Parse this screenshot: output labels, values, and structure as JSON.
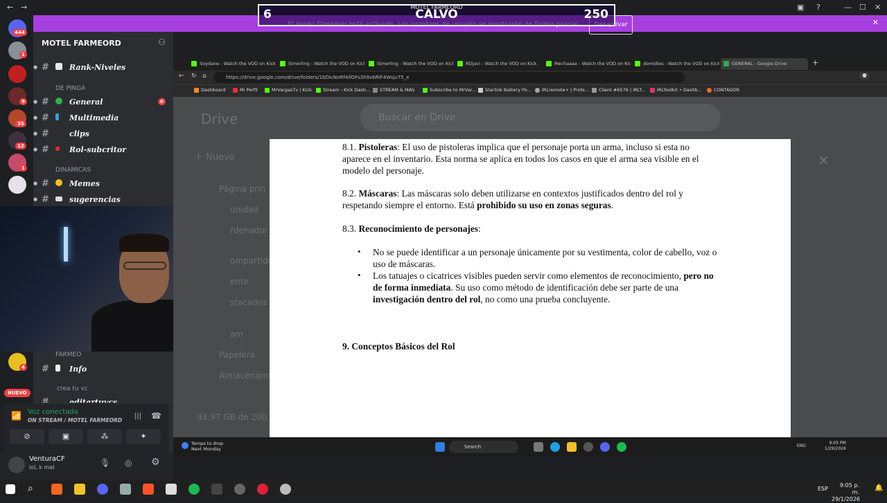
{
  "overlay": {
    "left_score": "6",
    "right_score": "250",
    "name": "CALVO",
    "server_label": "MOTEL FARMEORD"
  },
  "streamer_bar": {
    "message": "El modo Streamer está activado. Los nombres de usuario se mostrarán de forma parcial.",
    "button": "Desactivar",
    "color": "#a73fe0"
  },
  "rail": {
    "badges": [
      "444",
      "1",
      "9",
      "35",
      "12",
      "1",
      "4"
    ],
    "new_label": "NUEVO"
  },
  "sidebar": {
    "server_name": "MOTEL FARMEORD",
    "channels": [
      {
        "label": "Rank-Niveles"
      },
      {
        "category": "DE PINGA"
      },
      {
        "label": "General",
        "badge": "6"
      },
      {
        "label": "Multimedia"
      },
      {
        "label": "clips"
      },
      {
        "label": "Rol-subcritor"
      },
      {
        "category": "DINAMICAS"
      },
      {
        "label": "Memes"
      },
      {
        "label": "sugerencias"
      },
      {
        "category": "FARMEO"
      },
      {
        "label": "Info"
      },
      {
        "category": "crea tu vc"
      },
      {
        "label": "editartuvcs"
      }
    ]
  },
  "voice": {
    "title": "Voz conectada",
    "subtitle": "ON STREAM / MOTEL FARMEORD"
  },
  "user": {
    "name": "VenturaCF",
    "status": "lol, k mal"
  },
  "browser": {
    "tabs": [
      "Soydane - Watch the VOD on Kick",
      "iSmerling - Watch the VOD on Kick",
      "iSmerling - Watch the VOD on Kick",
      "RDjavi - Watch the VOD on Kick",
      "Mechaaax - Watch the VOD on Kick",
      "domidios - Watch the VOD on Kick",
      "GENERAL - Google Drive"
    ],
    "url": "https://drive.google.com/drive/folders/1bDicNnRf4ifOFs3h9vbRiF4Wsjv75_e",
    "bookmarks": [
      "Dashboard",
      "Mi Perfil",
      "MrVargasTv | Kick",
      "Stream - Kick Dash...",
      "STREAM & MAS",
      "Subscribe to MrVar...",
      "Starlink Battery Po...",
      "IRLremote+ | Profe...",
      "Client #6576 | IRLT...",
      "IRLToolkit • Dashb...",
      "CONTADOR"
    ]
  },
  "drive": {
    "logo": "Drive",
    "search_placeholder": "Buscar en Drive",
    "new_button": "Nuevo",
    "side_items": [
      "Página prin",
      "unidad",
      "rdenador",
      "ompartido",
      "ente",
      "stacados",
      "am",
      "Papelera",
      "Almacenami"
    ],
    "storage": "93,97 GB de 200"
  },
  "document": {
    "p81_num": "8.1.",
    "p81_head": "Pistoleras",
    "p81_text": ": El uso de pistoleras implica que el personaje porta un arma, incluso si esta no aparece en el inventario. Esta norma se aplica en todos los casos en que el arma sea visible en el modelo del personaje.",
    "p82_num": "8.2.",
    "p82_head": "Máscaras",
    "p82_text": ": Las máscaras solo deben utilizarse en contextos justificados dentro del rol y respetando siempre el entorno. Está ",
    "p82_bold": "prohibido su uso en zonas seguras",
    "p82_end": ".",
    "p83_num": "8.3.",
    "p83_head": "Reconocimiento de personajes",
    "p83_colon": ":",
    "bullet1": "No se puede identificar a un personaje únicamente por su vestimenta, color de cabello, voz o uso de máscaras.",
    "bullet2_a": "Los tatuajes o cicatrices visibles pueden servir como elementos de reconocimiento, ",
    "bullet2_b": "pero no de forma inmediata",
    "bullet2_c": ". Su uso como método de identificación debe ser parte de una ",
    "bullet2_d": "investigación dentro del rol",
    "bullet2_e": ", no como una prueba concluyente.",
    "section9": "9. Conceptos Básicos del Rol"
  },
  "inner_taskbar": {
    "weather_line1": "Temps to drop",
    "weather_line2": "Next Monday",
    "search": "Search",
    "lang": "ENG",
    "time": "9:05 PM",
    "date": "1/29/2026"
  },
  "taskbar": {
    "lang": "ESP",
    "time": "9:05 p. m.",
    "date": "29/1/2026"
  }
}
